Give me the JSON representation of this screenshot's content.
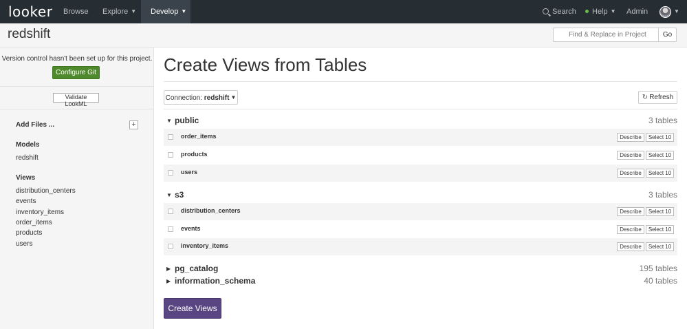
{
  "nav": {
    "logo": "looker",
    "browse": "Browse",
    "explore": "Explore",
    "develop": "Develop",
    "search": "Search",
    "help": "Help",
    "admin": "Admin"
  },
  "project": {
    "title": "redshift",
    "find_placeholder": "Find & Replace in Project",
    "go_label": "Go"
  },
  "sidebar": {
    "version_msg": "Version control hasn't been set up for this project.",
    "configure_git": "Configure Git",
    "validate": "Validate LookML",
    "add_files": "Add Files ...",
    "add_files_icon": "+",
    "models_heading": "Models",
    "models": [
      "redshift"
    ],
    "views_heading": "Views",
    "views": [
      "distribution_centers",
      "events",
      "inventory_items",
      "order_items",
      "products",
      "users"
    ]
  },
  "main": {
    "title": "Create Views from Tables",
    "connection_label": "Connection:",
    "connection_value": "redshift",
    "refresh": "Refresh",
    "describe_label": "Describe",
    "select_label": "Select 10",
    "create_views": "Create Views",
    "schemas": [
      {
        "name": "public",
        "count": "3 tables",
        "expanded": true,
        "tables": [
          "order_items",
          "products",
          "users"
        ]
      },
      {
        "name": "s3",
        "count": "3 tables",
        "expanded": true,
        "tables": [
          "distribution_centers",
          "events",
          "inventory_items"
        ]
      },
      {
        "name": "pg_catalog",
        "count": "195 tables",
        "expanded": false,
        "tables": []
      },
      {
        "name": "information_schema",
        "count": "40 tables",
        "expanded": false,
        "tables": []
      }
    ]
  },
  "colors": {
    "nav_bg": "#262d33",
    "git_green": "#4e8a2b",
    "create_purple": "#5a4583"
  }
}
